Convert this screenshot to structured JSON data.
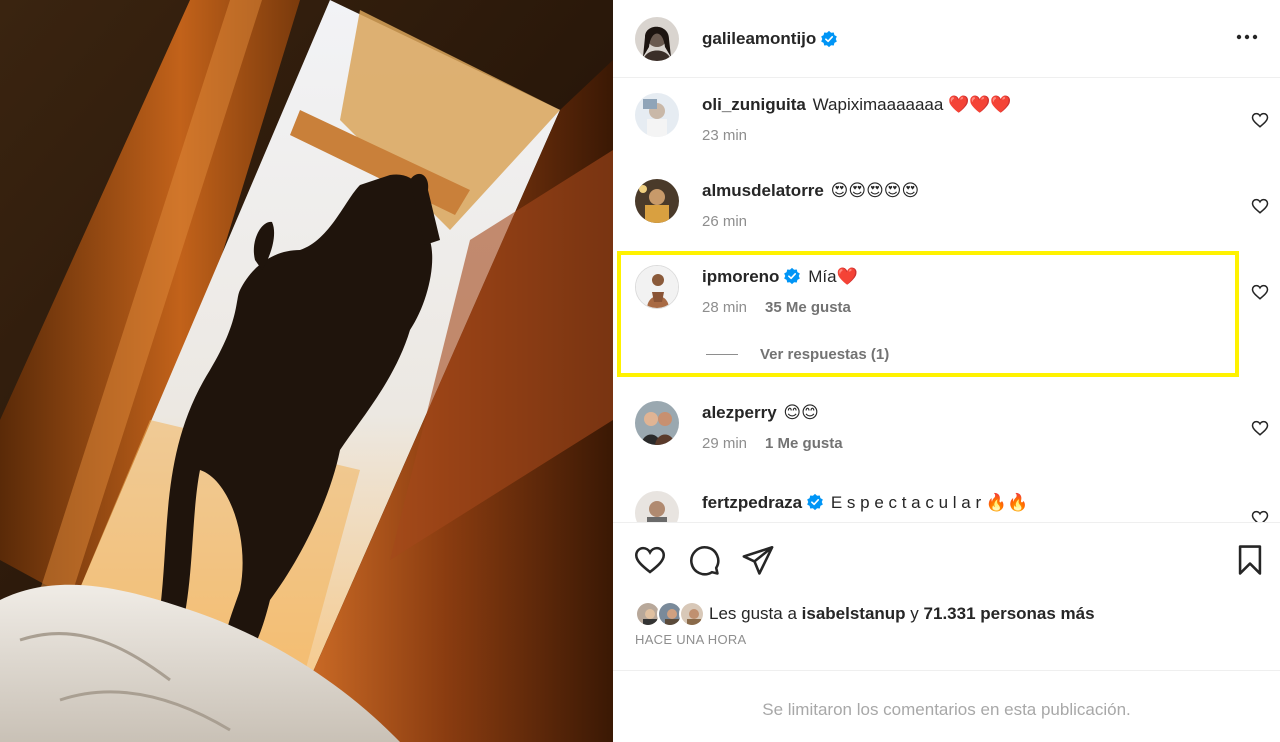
{
  "post": {
    "author": "galileamontijo",
    "author_verified": true,
    "more_icon": "more-horizontal-icon"
  },
  "comments": [
    {
      "username": "oli_zuniguita",
      "text": "Wapiximaaaaaaa ❤️❤️❤️",
      "time": "23 min",
      "likes": "",
      "verified": false
    },
    {
      "username": "almusdelatorre",
      "text": "😍😍😍😍😍",
      "time": "26 min",
      "likes": "",
      "verified": false
    },
    {
      "username": "ipmoreno",
      "text": "Mía❤️",
      "time": "28 min",
      "likes": "35 Me gusta",
      "verified": true,
      "replies": "Ver respuestas (1)",
      "highlighted": true
    },
    {
      "username": "alezperry",
      "text": "😊😊",
      "time": "29 min",
      "likes": "1 Me gusta",
      "verified": false
    },
    {
      "username": "fertzpedraza",
      "text": "E s p e c t a c u l a r 🔥🔥",
      "time": "",
      "likes": "",
      "verified": true
    }
  ],
  "actions": {
    "like_icon": "heart-icon",
    "comment_icon": "comment-icon",
    "share_icon": "send-icon",
    "save_icon": "bookmark-icon"
  },
  "likes_summary": {
    "prefix": "Les gusta a",
    "user": "isabelstanup",
    "connector": "y",
    "others": "71.331 personas más"
  },
  "posted_time": "HACE UNA HORA",
  "comments_limited": "Se limitaron los comentarios en esta publicación.",
  "colors": {
    "highlight": "#fff200",
    "verified": "#0095f6",
    "text": "#262626",
    "muted": "#8e8e8e"
  }
}
